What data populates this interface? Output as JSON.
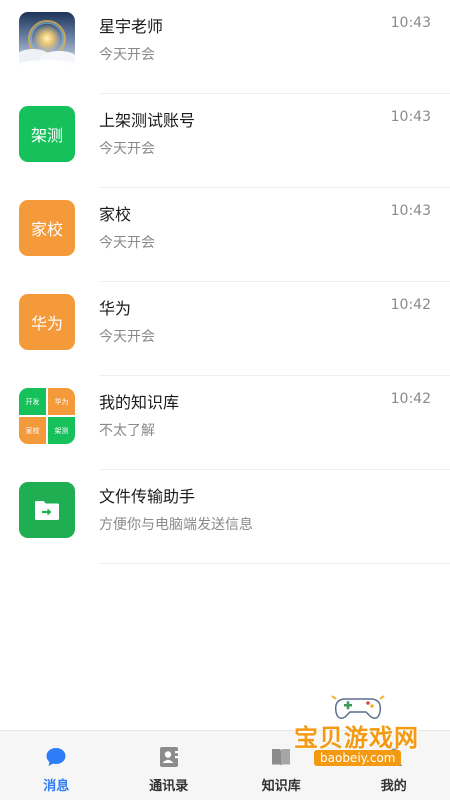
{
  "chats": [
    {
      "name": "星宇老师",
      "preview": "今天开会",
      "time": "10:43",
      "avatar": "sky-photo"
    },
    {
      "name": "上架测试账号",
      "preview": "今天开会",
      "time": "10:43",
      "avatar_text": "架测",
      "color": "#16c15c"
    },
    {
      "name": "家校",
      "preview": "今天开会",
      "time": "10:43",
      "avatar_text": "家校",
      "color": "#f59a3a"
    },
    {
      "name": "华为",
      "preview": "今天开会",
      "time": "10:42",
      "avatar_text": "华为",
      "color": "#f59a3a"
    },
    {
      "name": "我的知识库",
      "preview": "不太了解",
      "time": "10:42",
      "avatar_cells": [
        "开发",
        "华为",
        "家校",
        "架测"
      ]
    },
    {
      "name": "文件传输助手",
      "preview": "方便你与电脑端发送信息",
      "time": "",
      "avatar": "folder-icon",
      "color": "#1fae52"
    }
  ],
  "tabs": [
    {
      "label": "消息",
      "icon": "chat-bubble-icon",
      "active": true
    },
    {
      "label": "通讯录",
      "icon": "contacts-icon",
      "active": false
    },
    {
      "label": "知识库",
      "icon": "book-icon",
      "active": false
    },
    {
      "label": "我的",
      "icon": "user-icon",
      "active": false
    }
  ],
  "watermark": {
    "text": "宝贝游戏网",
    "url": "baobeiy.com"
  },
  "colors": {
    "accent": "#2f7df6",
    "green": "#16c15c",
    "orange": "#f59a3a"
  }
}
